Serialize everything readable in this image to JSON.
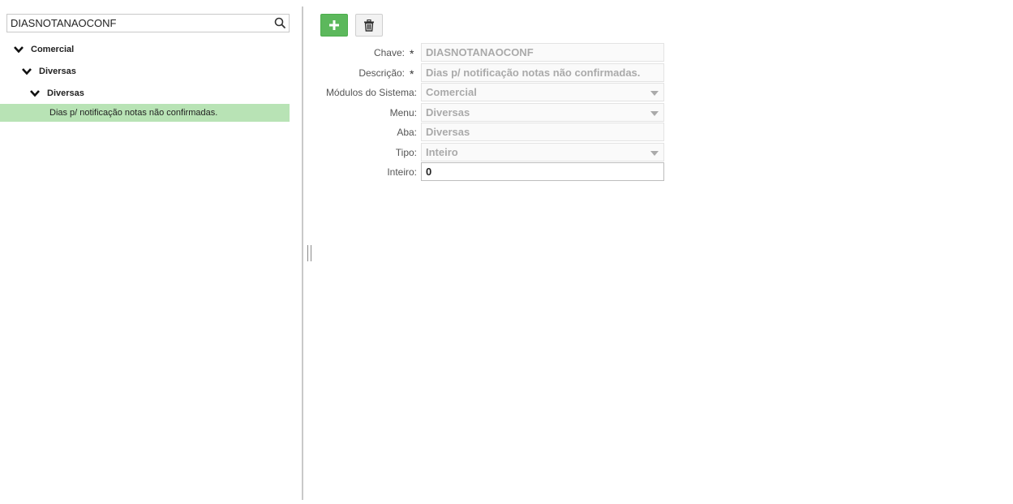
{
  "search": {
    "value": "DIASNOTANAOCONF",
    "icon": "search-icon"
  },
  "tree": {
    "level1_label": "Comercial",
    "level2_label": "Diversas",
    "level3_label": "Diversas",
    "leaf_label": "Dias p/ notificação notas não confirmadas."
  },
  "toolbar": {
    "add_icon": "plus-icon",
    "delete_icon": "trash-icon"
  },
  "form": {
    "chave": {
      "label": "Chave:",
      "required": "*",
      "value": "DIASNOTANAOCONF"
    },
    "descricao": {
      "label": "Descrição:",
      "required": "*",
      "value": "Dias p/ notificação notas não confirmadas."
    },
    "modulos": {
      "label": "Módulos do Sistema:",
      "value": "Comercial"
    },
    "menu": {
      "label": "Menu:",
      "value": "Diversas"
    },
    "aba": {
      "label": "Aba:",
      "value": "Diversas"
    },
    "tipo": {
      "label": "Tipo:",
      "value": "Inteiro"
    },
    "inteiro": {
      "label": "Inteiro:",
      "value": "0"
    }
  },
  "colors": {
    "accent_green": "#5cb85c",
    "selected_row": "#b8e3b5",
    "disabled_text": "#aaaaaa"
  }
}
